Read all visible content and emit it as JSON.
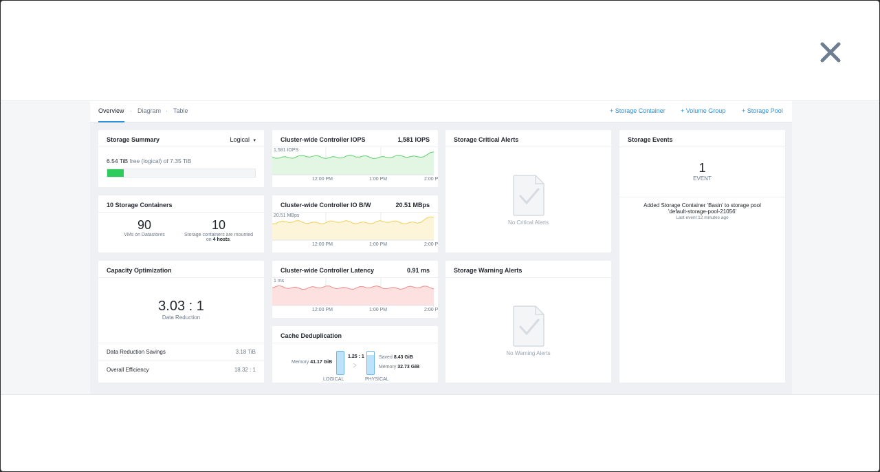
{
  "modal": {
    "close_icon": "close-icon"
  },
  "tabs": {
    "overview": "Overview",
    "diagram": "Diagram",
    "table": "Table",
    "sep": "·"
  },
  "actions": {
    "storage_container": "+ Storage Container",
    "volume_group": "+ Volume Group",
    "storage_pool": "+ Storage Pool"
  },
  "storage_summary": {
    "title": "Storage Summary",
    "mode": "Logical",
    "free": "6.54 TiB",
    "free_suffix": "free (logical) of",
    "total": "7.35 TiB",
    "usage_fraction": 0.11,
    "bar_color": "#2ecc5b"
  },
  "containers": {
    "title": "10 Storage Containers",
    "vms_count": "90",
    "vms_label": "VMs on Datastores",
    "mounted_count": "10",
    "mounted_label_1": "Storage containers are mounted",
    "mounted_label_2": "on",
    "mounted_hosts": "4 hosts",
    "mounted_end": "."
  },
  "capacity": {
    "title": "Capacity Optimization",
    "ratio": "3.03 : 1",
    "ratio_label": "Data Reduction",
    "savings_label": "Data Reduction Savings",
    "savings_value": "3.18 TiB",
    "efficiency_label": "Overall Efficiency",
    "efficiency_value": "18.32 : 1"
  },
  "iops": {
    "title": "Cluster-wide Controller IOPS",
    "value": "1,581 IOPS",
    "peak_label": "1,581 IOPS",
    "color": "#5fcf6c",
    "fill": "#e3f6e4",
    "x_ticks": [
      "12:00 PM",
      "1:00 PM",
      "2:00 P"
    ]
  },
  "iobw": {
    "title": "Cluster-wide Controller IO B/W",
    "value": "20.51 MBps",
    "peak_label": "20.51 MBps",
    "color": "#f2cf5b",
    "fill": "#fdf5d9",
    "x_ticks": [
      "12:00 PM",
      "1:00 PM",
      "2:00 P"
    ]
  },
  "latency": {
    "title": "Cluster-wide Controller Latency",
    "value": "0.91 ms",
    "peak_label": "1 ms",
    "color": "#ef8c8c",
    "fill": "#fde1e1",
    "x_ticks": [
      "12:00 PM",
      "1:00 PM",
      "2:00 P"
    ]
  },
  "dedup": {
    "title": "Cache Deduplication",
    "memory_label": "Memory",
    "memory_logical": "41.17 GiB",
    "ratio": "1.25 : 1",
    "saved_label": "Saved",
    "saved_value": "8.43 GiB",
    "memory_physical": "32.73 GiB",
    "logical_label": "LOGICAL",
    "physical_label": "PHYSICAL"
  },
  "critical_alerts": {
    "title": "Storage Critical Alerts",
    "empty": "No Critical Alerts"
  },
  "warning_alerts": {
    "title": "Storage Warning Alerts",
    "empty": "No Warning Alerts"
  },
  "events": {
    "title": "Storage Events",
    "count": "1",
    "count_label": "EVENT",
    "message_1": "Added Storage Container 'Basin' to storage pool",
    "message_2": "'default-storage-pool-21056'",
    "last": "Last event 12 minutes ago"
  }
}
